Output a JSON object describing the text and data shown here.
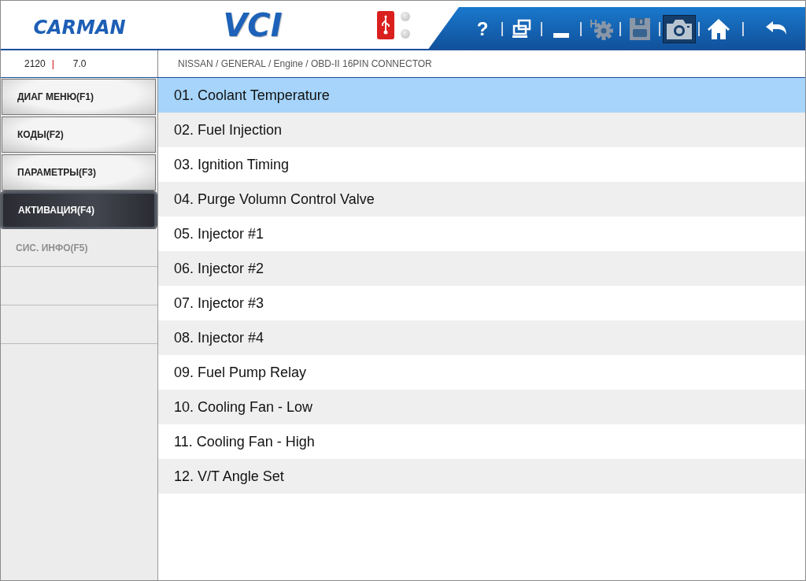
{
  "header": {
    "logo": "CARMAN",
    "product": "VCI",
    "toolbar": [
      {
        "kind": "help",
        "label": "?",
        "disabled": false,
        "selected": false
      },
      {
        "kind": "windows",
        "disabled": false,
        "selected": false
      },
      {
        "kind": "minimize",
        "disabled": false,
        "selected": false
      },
      {
        "kind": "settings",
        "disabled": true,
        "selected": false
      },
      {
        "kind": "save",
        "disabled": true,
        "selected": false
      },
      {
        "kind": "camera",
        "disabled": false,
        "selected": true
      },
      {
        "kind": "home",
        "disabled": false,
        "selected": false
      },
      {
        "kind": "back",
        "disabled": false,
        "selected": false
      }
    ]
  },
  "info": {
    "code": "2120",
    "separator": "|",
    "version": "7.0",
    "breadcrumb": "NISSAN / GENERAL / Engine / OBD-II 16PIN CONNECTOR"
  },
  "sidebar": {
    "items": [
      {
        "label": "ДИАГ МЕНЮ(F1)",
        "selected": false,
        "disabled": false
      },
      {
        "label": "КОДЫ(F2)",
        "selected": false,
        "disabled": false
      },
      {
        "label": "ПАРАМЕТРЫ(F3)",
        "selected": false,
        "disabled": false
      },
      {
        "label": "АКТИВАЦИЯ(F4)",
        "selected": true,
        "disabled": false
      },
      {
        "label": "СИС. ИНФО(F5)",
        "selected": false,
        "disabled": true
      }
    ]
  },
  "list": {
    "items": [
      {
        "label": "01. Coolant Temperature",
        "selected": true
      },
      {
        "label": "02. Fuel Injection",
        "selected": false
      },
      {
        "label": "03. Ignition Timing",
        "selected": false
      },
      {
        "label": "04. Purge Volumn Control Valve",
        "selected": false
      },
      {
        "label": "05. Injector #1",
        "selected": false
      },
      {
        "label": "06. Injector #2",
        "selected": false
      },
      {
        "label": "07. Injector #3",
        "selected": false
      },
      {
        "label": "08. Injector #4",
        "selected": false
      },
      {
        "label": "09. Fuel Pump Relay",
        "selected": false
      },
      {
        "label": "10. Cooling Fan - Low",
        "selected": false
      },
      {
        "label": "11. Cooling Fan - High",
        "selected": false
      },
      {
        "label": "12. V/T Angle Set",
        "selected": false
      }
    ]
  }
}
